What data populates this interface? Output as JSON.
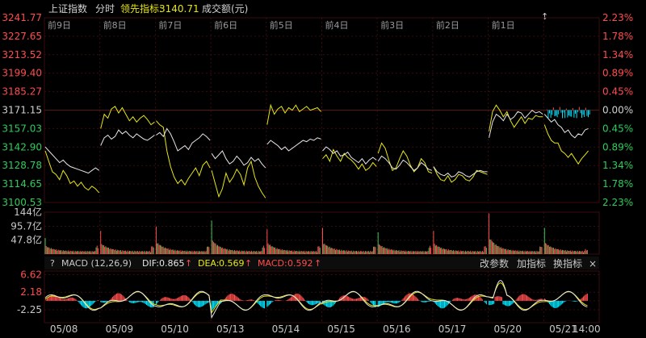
{
  "header": {
    "index_name": "上证指数",
    "mode": "分时",
    "leader_label": "领先指标:",
    "leader_value": "3140.71",
    "volume_label": "成交额(元)"
  },
  "macd_bar": {
    "help_icon": "?",
    "title": "MACD (12,26,9)",
    "dif_label": "DIF:",
    "dif_value": "0.865",
    "dea_label": "DEA:",
    "dea_value": "0.569",
    "macd_label": "MACD:",
    "macd_value": "0.592",
    "up_arrow": "↑",
    "change_params": "改参数",
    "add_indicator": "加指标",
    "switch_indicator": "换指标",
    "close_icon": "×"
  },
  "colors": {
    "background": "#000000",
    "grid": "#3a0d0d",
    "up": "#ff4d4d",
    "down": "#2fcc5a",
    "price_line": "#e6e6e6",
    "leader_line": "#e6e614",
    "cyan": "#00e5ff",
    "text": "#c8c8c8"
  },
  "chart_data": {
    "type": "line",
    "days": [
      "前9日",
      "前8日",
      "前7日",
      "前6日",
      "前5日",
      "前4日",
      "前3日",
      "前2日",
      "前1日"
    ],
    "dates": [
      "05/08",
      "05/09",
      "05/10",
      "05/13",
      "05/14",
      "05/15",
      "05/16",
      "05/17",
      "05/20",
      "05/21"
    ],
    "last_time": "14:00",
    "price_axis": {
      "ticks": [
        "3241.77",
        "3227.65",
        "3213.52",
        "3199.40",
        "3185.27",
        "3171.15",
        "3157.03",
        "3142.90",
        "3128.78",
        "3114.65",
        "3100.53"
      ],
      "min": 3100.53,
      "max": 3241.77,
      "base": 3171.15
    },
    "percent_axis": {
      "ticks": [
        "2.23%",
        "1.78%",
        "1.34%",
        "0.89%",
        "0.45%",
        "0.00%",
        "0.45%",
        "0.89%",
        "1.34%",
        "1.78%",
        "2.23%"
      ]
    },
    "volume_axis": {
      "ticks": [
        "144亿",
        "95.7亿",
        "47.8亿"
      ],
      "max": 144
    },
    "macd_axis": {
      "ticks": [
        "6.62",
        "2.18",
        "-2.25"
      ],
      "min": -5.5,
      "max": 7.5
    },
    "series": [
      {
        "name": "上证指数",
        "color": "#e6e6e6",
        "days": [
          [
            3143,
            3140,
            3137,
            3134,
            3131,
            3133,
            3130,
            3128,
            3127,
            3126,
            3125,
            3124,
            3123,
            3125,
            3127,
            3125
          ],
          [
            3144,
            3150,
            3152,
            3149,
            3151,
            3156,
            3153,
            3155,
            3152,
            3150,
            3153,
            3151,
            3149,
            3148,
            3150,
            3152
          ],
          [
            3152,
            3154,
            3151,
            3157,
            3153,
            3147,
            3140,
            3142,
            3144,
            3141,
            3146,
            3148,
            3150,
            3153,
            3151,
            3148
          ],
          [
            3138,
            3134,
            3137,
            3140,
            3134,
            3130,
            3132,
            3136,
            3133,
            3129,
            3131,
            3135,
            3132,
            3134,
            3130,
            3127
          ],
          [
            3145,
            3148,
            3146,
            3144,
            3141,
            3143,
            3140,
            3142,
            3144,
            3146,
            3148,
            3147,
            3149,
            3148,
            3150,
            3149
          ],
          [
            3140,
            3143,
            3141,
            3138,
            3140,
            3136,
            3137,
            3139,
            3135,
            3133,
            3131,
            3134,
            3130,
            3133,
            3135,
            3133
          ],
          [
            3132,
            3136,
            3134,
            3131,
            3127,
            3126,
            3129,
            3133,
            3131,
            3128,
            3125,
            3127,
            3131,
            3129,
            3126,
            3125
          ],
          [
            3128,
            3124,
            3122,
            3121,
            3123,
            3120,
            3121,
            3124,
            3123,
            3121,
            3120,
            3122,
            3124,
            3125,
            3124,
            3124
          ],
          [
            3150,
            3162,
            3168,
            3166,
            3163,
            3168,
            3164,
            3166,
            3170,
            3169,
            3165,
            3168,
            3171,
            3169,
            3170,
            3168
          ],
          [
            3168,
            3165,
            3162,
            3164,
            3160,
            3158,
            3154,
            3156,
            3152,
            3150,
            3153,
            3152,
            3156,
            3157
          ]
        ]
      },
      {
        "name": "领先指标",
        "color": "#e6e614",
        "days": [
          [
            3140,
            3132,
            3124,
            3122,
            3118,
            3125,
            3121,
            3115,
            3117,
            3113,
            3116,
            3112,
            3110,
            3113,
            3111,
            3108
          ],
          [
            3157,
            3168,
            3165,
            3172,
            3174,
            3169,
            3173,
            3168,
            3163,
            3166,
            3162,
            3165,
            3167,
            3164,
            3160,
            3162
          ],
          [
            3163,
            3160,
            3158,
            3140,
            3128,
            3120,
            3115,
            3118,
            3114,
            3119,
            3123,
            3127,
            3121,
            3129,
            3132,
            3127
          ],
          [
            3125,
            3115,
            3105,
            3111,
            3123,
            3116,
            3120,
            3126,
            3122,
            3114,
            3127,
            3132,
            3120,
            3113,
            3108,
            3104
          ],
          [
            3160,
            3175,
            3168,
            3172,
            3174,
            3169,
            3173,
            3171,
            3175,
            3170,
            3172,
            3174,
            3171,
            3172,
            3173,
            3170
          ],
          [
            3134,
            3137,
            3132,
            3141,
            3136,
            3132,
            3138,
            3135,
            3133,
            3130,
            3126,
            3130,
            3125,
            3127,
            3131,
            3128
          ],
          [
            3138,
            3146,
            3142,
            3133,
            3125,
            3127,
            3134,
            3140,
            3136,
            3129,
            3124,
            3127,
            3134,
            3131,
            3124,
            3123
          ],
          [
            3128,
            3122,
            3118,
            3117,
            3121,
            3116,
            3118,
            3122,
            3121,
            3118,
            3117,
            3120,
            3125,
            3124,
            3123,
            3122
          ],
          [
            3155,
            3170,
            3175,
            3171,
            3166,
            3170,
            3163,
            3158,
            3162,
            3166,
            3161,
            3165,
            3164,
            3167,
            3166,
            3166
          ],
          [
            3160,
            3153,
            3148,
            3146,
            3146,
            3140,
            3138,
            3135,
            3138,
            3134,
            3130,
            3134,
            3137,
            3140
          ]
        ]
      }
    ],
    "xlabel": "",
    "ylabel": ""
  }
}
